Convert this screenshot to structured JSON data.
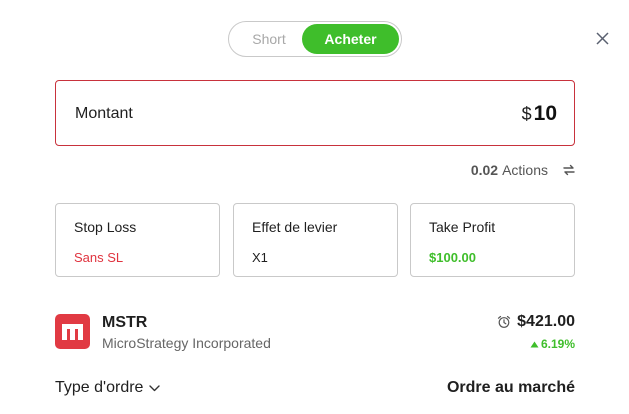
{
  "toggle": {
    "short_label": "Short",
    "buy_label": "Acheter",
    "active": "Acheter"
  },
  "amount": {
    "label": "Montant",
    "currency": "$",
    "value": "10"
  },
  "units": {
    "value": "0.02",
    "label": "Actions"
  },
  "cards": {
    "stop_loss": {
      "title": "Stop Loss",
      "value": "Sans SL",
      "value_color": "#e0333f"
    },
    "leverage": {
      "title": "Effet de levier",
      "value": "X1",
      "value_color": "#1f1f1f"
    },
    "take_profit": {
      "title": "Take Profit",
      "value": "$100.00",
      "value_color": "#3fbe2b"
    }
  },
  "asset": {
    "symbol": "MSTR",
    "name": "MicroStrategy Incorporated",
    "price": "$421.00",
    "change": "6.19%",
    "change_direction": "up"
  },
  "order": {
    "type_label": "Type d'ordre",
    "mode": "Ordre au marché"
  },
  "colors": {
    "accent_green": "#3fbe2b",
    "error_red": "#c8323c",
    "logo_red": "#e13a43"
  },
  "icons": [
    "close-icon",
    "swap-icon",
    "alarm-clock-icon",
    "caret-up-icon",
    "chevron-down-icon",
    "microstrategy-logo"
  ]
}
